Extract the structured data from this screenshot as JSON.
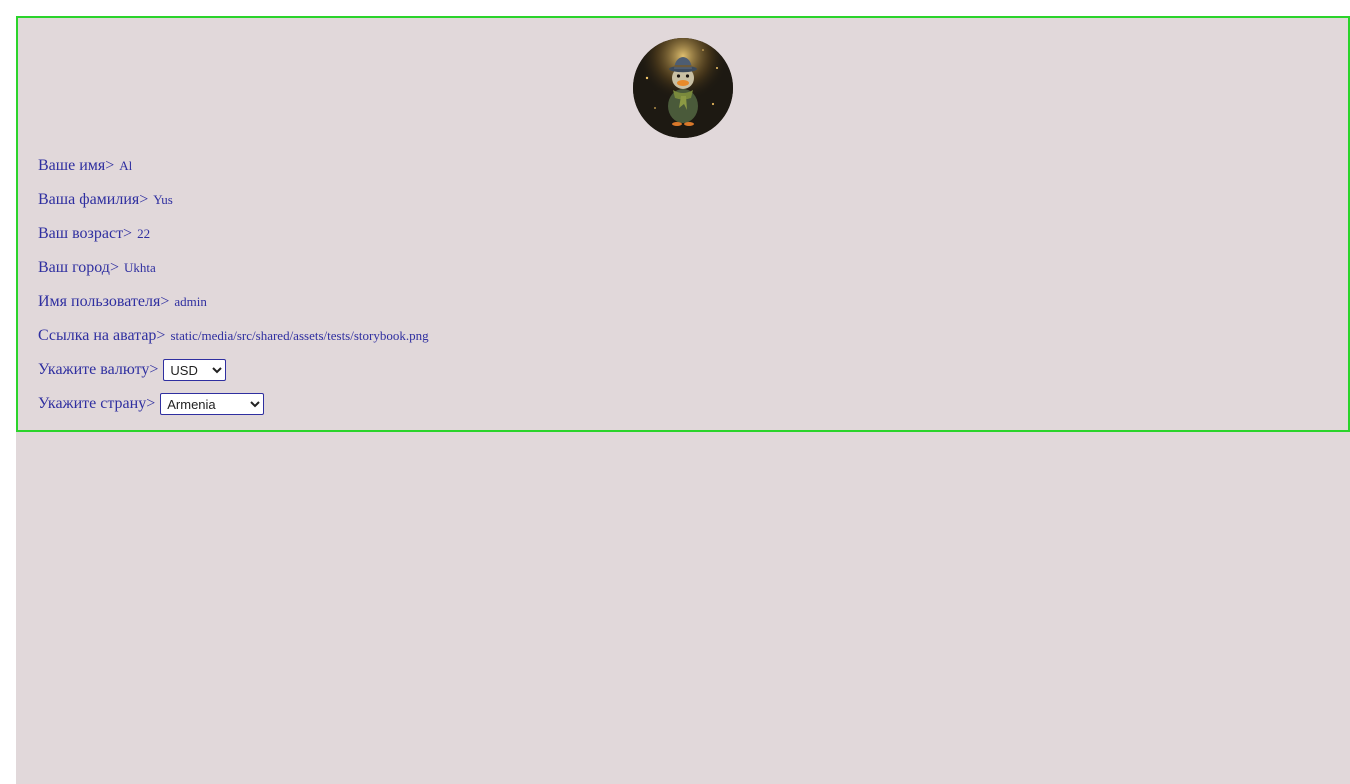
{
  "profile": {
    "first_name_label": "Ваше имя>",
    "first_name": "Al",
    "last_name_label": "Ваша фамилия>",
    "last_name": "Yus",
    "age_label": "Ваш возраст>",
    "age": "22",
    "city_label": "Ваш город>",
    "city": "Ukhta",
    "username_label": "Имя пользователя>",
    "username": "admin",
    "avatar_label": "Ссылка на аватар>",
    "avatar_link": "static/media/src/shared/assets/tests/storybook.png",
    "currency_label": "Укажите валюту>",
    "currency_selected": "USD",
    "country_label": "Укажите страну>",
    "country_selected": "Armenia"
  },
  "colors": {
    "card_border": "#2bd42b",
    "background": "#e1d8da",
    "text": "#2f2fa0"
  },
  "icons": {
    "avatar": "duck-avatar-image"
  }
}
